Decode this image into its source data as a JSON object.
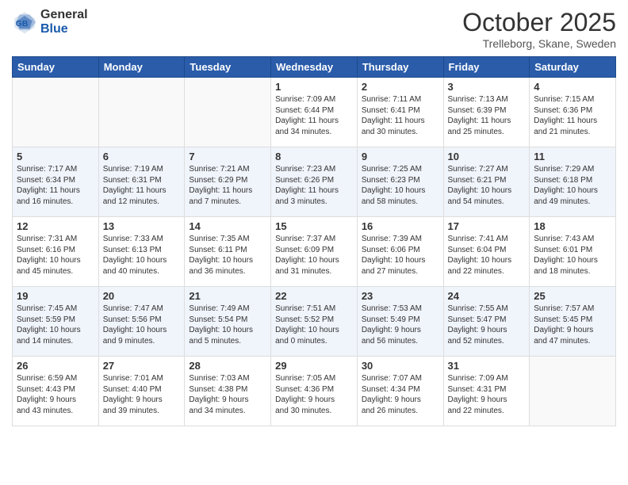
{
  "logo": {
    "general": "General",
    "blue": "Blue"
  },
  "header": {
    "month": "October 2025",
    "location": "Trelleborg, Skane, Sweden"
  },
  "days_of_week": [
    "Sunday",
    "Monday",
    "Tuesday",
    "Wednesday",
    "Thursday",
    "Friday",
    "Saturday"
  ],
  "weeks": [
    [
      {
        "day": "",
        "info": ""
      },
      {
        "day": "",
        "info": ""
      },
      {
        "day": "",
        "info": ""
      },
      {
        "day": "1",
        "info": "Sunrise: 7:09 AM\nSunset: 6:44 PM\nDaylight: 11 hours\nand 34 minutes."
      },
      {
        "day": "2",
        "info": "Sunrise: 7:11 AM\nSunset: 6:41 PM\nDaylight: 11 hours\nand 30 minutes."
      },
      {
        "day": "3",
        "info": "Sunrise: 7:13 AM\nSunset: 6:39 PM\nDaylight: 11 hours\nand 25 minutes."
      },
      {
        "day": "4",
        "info": "Sunrise: 7:15 AM\nSunset: 6:36 PM\nDaylight: 11 hours\nand 21 minutes."
      }
    ],
    [
      {
        "day": "5",
        "info": "Sunrise: 7:17 AM\nSunset: 6:34 PM\nDaylight: 11 hours\nand 16 minutes."
      },
      {
        "day": "6",
        "info": "Sunrise: 7:19 AM\nSunset: 6:31 PM\nDaylight: 11 hours\nand 12 minutes."
      },
      {
        "day": "7",
        "info": "Sunrise: 7:21 AM\nSunset: 6:29 PM\nDaylight: 11 hours\nand 7 minutes."
      },
      {
        "day": "8",
        "info": "Sunrise: 7:23 AM\nSunset: 6:26 PM\nDaylight: 11 hours\nand 3 minutes."
      },
      {
        "day": "9",
        "info": "Sunrise: 7:25 AM\nSunset: 6:23 PM\nDaylight: 10 hours\nand 58 minutes."
      },
      {
        "day": "10",
        "info": "Sunrise: 7:27 AM\nSunset: 6:21 PM\nDaylight: 10 hours\nand 54 minutes."
      },
      {
        "day": "11",
        "info": "Sunrise: 7:29 AM\nSunset: 6:18 PM\nDaylight: 10 hours\nand 49 minutes."
      }
    ],
    [
      {
        "day": "12",
        "info": "Sunrise: 7:31 AM\nSunset: 6:16 PM\nDaylight: 10 hours\nand 45 minutes."
      },
      {
        "day": "13",
        "info": "Sunrise: 7:33 AM\nSunset: 6:13 PM\nDaylight: 10 hours\nand 40 minutes."
      },
      {
        "day": "14",
        "info": "Sunrise: 7:35 AM\nSunset: 6:11 PM\nDaylight: 10 hours\nand 36 minutes."
      },
      {
        "day": "15",
        "info": "Sunrise: 7:37 AM\nSunset: 6:09 PM\nDaylight: 10 hours\nand 31 minutes."
      },
      {
        "day": "16",
        "info": "Sunrise: 7:39 AM\nSunset: 6:06 PM\nDaylight: 10 hours\nand 27 minutes."
      },
      {
        "day": "17",
        "info": "Sunrise: 7:41 AM\nSunset: 6:04 PM\nDaylight: 10 hours\nand 22 minutes."
      },
      {
        "day": "18",
        "info": "Sunrise: 7:43 AM\nSunset: 6:01 PM\nDaylight: 10 hours\nand 18 minutes."
      }
    ],
    [
      {
        "day": "19",
        "info": "Sunrise: 7:45 AM\nSunset: 5:59 PM\nDaylight: 10 hours\nand 14 minutes."
      },
      {
        "day": "20",
        "info": "Sunrise: 7:47 AM\nSunset: 5:56 PM\nDaylight: 10 hours\nand 9 minutes."
      },
      {
        "day": "21",
        "info": "Sunrise: 7:49 AM\nSunset: 5:54 PM\nDaylight: 10 hours\nand 5 minutes."
      },
      {
        "day": "22",
        "info": "Sunrise: 7:51 AM\nSunset: 5:52 PM\nDaylight: 10 hours\nand 0 minutes."
      },
      {
        "day": "23",
        "info": "Sunrise: 7:53 AM\nSunset: 5:49 PM\nDaylight: 9 hours\nand 56 minutes."
      },
      {
        "day": "24",
        "info": "Sunrise: 7:55 AM\nSunset: 5:47 PM\nDaylight: 9 hours\nand 52 minutes."
      },
      {
        "day": "25",
        "info": "Sunrise: 7:57 AM\nSunset: 5:45 PM\nDaylight: 9 hours\nand 47 minutes."
      }
    ],
    [
      {
        "day": "26",
        "info": "Sunrise: 6:59 AM\nSunset: 4:43 PM\nDaylight: 9 hours\nand 43 minutes."
      },
      {
        "day": "27",
        "info": "Sunrise: 7:01 AM\nSunset: 4:40 PM\nDaylight: 9 hours\nand 39 minutes."
      },
      {
        "day": "28",
        "info": "Sunrise: 7:03 AM\nSunset: 4:38 PM\nDaylight: 9 hours\nand 34 minutes."
      },
      {
        "day": "29",
        "info": "Sunrise: 7:05 AM\nSunset: 4:36 PM\nDaylight: 9 hours\nand 30 minutes."
      },
      {
        "day": "30",
        "info": "Sunrise: 7:07 AM\nSunset: 4:34 PM\nDaylight: 9 hours\nand 26 minutes."
      },
      {
        "day": "31",
        "info": "Sunrise: 7:09 AM\nSunset: 4:31 PM\nDaylight: 9 hours\nand 22 minutes."
      },
      {
        "day": "",
        "info": ""
      }
    ]
  ]
}
